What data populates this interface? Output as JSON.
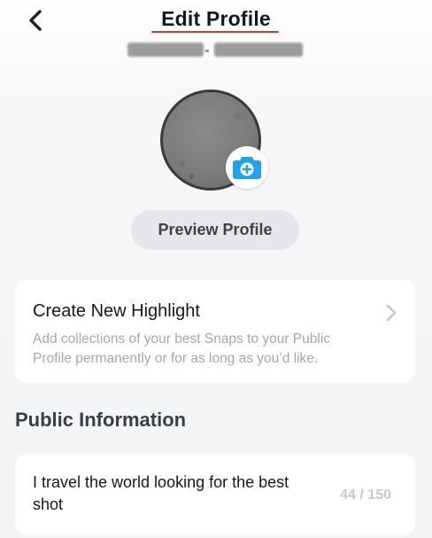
{
  "header": {
    "title": "Edit Profile"
  },
  "preview_button": {
    "label": "Preview Profile"
  },
  "highlight_card": {
    "title": "Create New Highlight",
    "description": "Add collections of your best Snaps to your Public Profile permanently or for as long as you’d like."
  },
  "public_info": {
    "section_title": "Public Information",
    "bio": "I travel the world looking for the best shot",
    "char_count": "44 / 150"
  },
  "colors": {
    "accent_blue": "#1fa3ec",
    "underline_red": "#e0342b",
    "card_bg": "#ffffff",
    "muted_text": "#a3a7ad"
  },
  "icons": {
    "back": "chevron-left-icon",
    "camera": "camera-plus-icon",
    "chevron": "chevron-right-icon"
  }
}
